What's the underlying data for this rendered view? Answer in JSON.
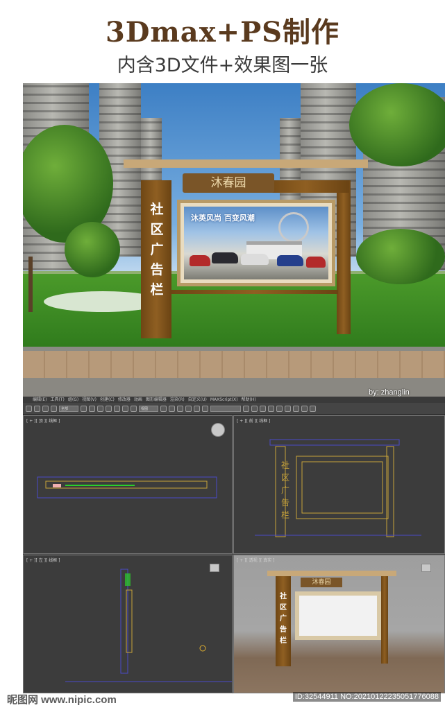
{
  "header": {
    "title": "3Dmax+PS制作",
    "subtitle": "内含3D文件+效果图一张"
  },
  "render": {
    "header_sign": "沐春园",
    "side_text": [
      "社",
      "区",
      "广",
      "告",
      "栏"
    ],
    "poster_title": "沐英风尚 百变风潮",
    "credit": "by:  zhanglin"
  },
  "max": {
    "menu_items": [
      "编辑(E)",
      "工具(T)",
      "组(G)",
      "视图(V)",
      "创建(C)",
      "修改器",
      "动画",
      "图形编辑器",
      "渲染(R)",
      "自定义(U)",
      "MAXScript(X)",
      "帮助(H)"
    ],
    "toolbar_dropdowns": [
      "全部",
      "视图",
      ""
    ],
    "viewports": {
      "top": "[ + ][ 顶 ][ 线框 ]",
      "front": "[ + ][ 前 ][ 线框 ]",
      "left": "[ + ][ 左 ][ 线框 ]",
      "perspective": "[ + ][ 透视 ][ 真实 ]"
    },
    "front_vertical_text": [
      "社",
      "区",
      "广",
      "告",
      "栏"
    ],
    "persp_sign": "沐春园",
    "persp_vertical_text": [
      "社",
      "区",
      "广",
      "告",
      "栏"
    ]
  },
  "footer": {
    "watermark": "昵图网 www.nipic.com",
    "id_text": "ID:32544911 NO:20210122235051776088"
  },
  "colors": {
    "title": "#5a3a1e",
    "wood": "#8f5f22",
    "wire": "#c9a43a"
  }
}
